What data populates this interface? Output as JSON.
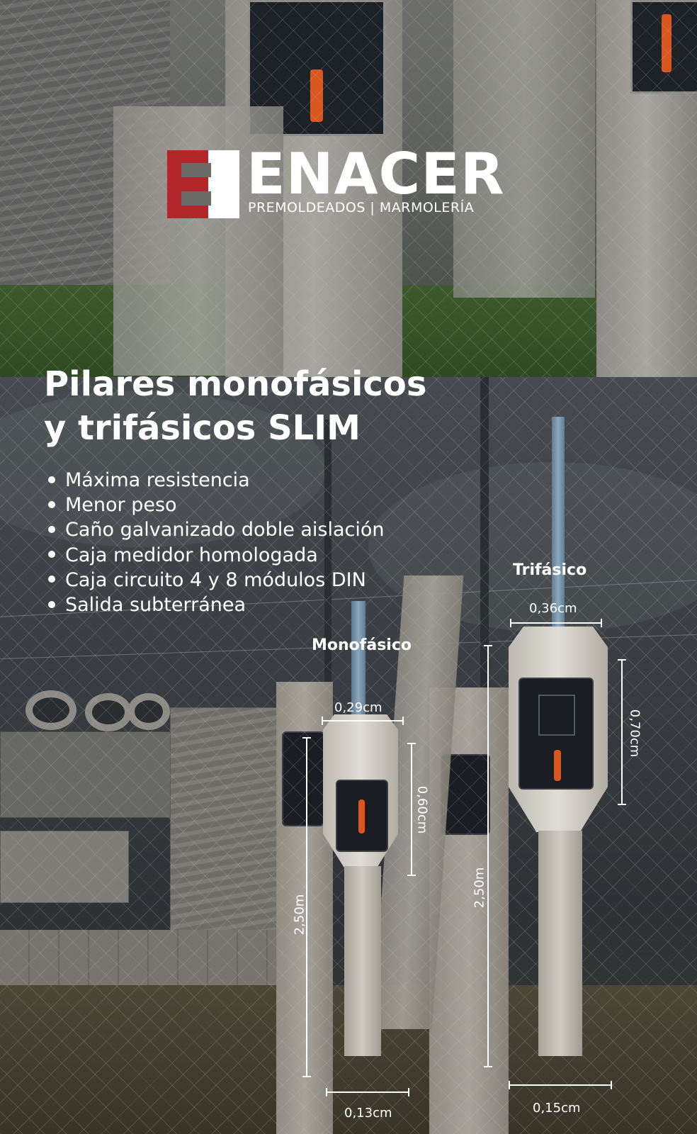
{
  "brand": {
    "name": "ENACER",
    "tagline": "PREMOLDEADOS | MARMOLERÍA",
    "colors": {
      "mark_red": "#b3272b",
      "mark_white": "#ffffff"
    }
  },
  "headline": {
    "line1": "Pilares monofásicos",
    "line2": "y trifásicos SLIM"
  },
  "features": [
    "Máxima resistencia",
    "Menor peso",
    "Caño galvanizado doble aislación",
    "Caja medidor homologada",
    "Caja circuito 4 y 8 módulos DIN",
    "Salida subterránea"
  ],
  "products": {
    "monofasico": {
      "label": "Monofásico",
      "head_width": "0,29cm",
      "head_height": "0,60cm",
      "total_height": "2,50m",
      "base_width": "0,13cm"
    },
    "trifasico": {
      "label": "Trifásico",
      "head_width": "0,36cm",
      "head_height": "0,70cm",
      "total_height": "2,50m",
      "base_width": "0,15cm"
    }
  }
}
